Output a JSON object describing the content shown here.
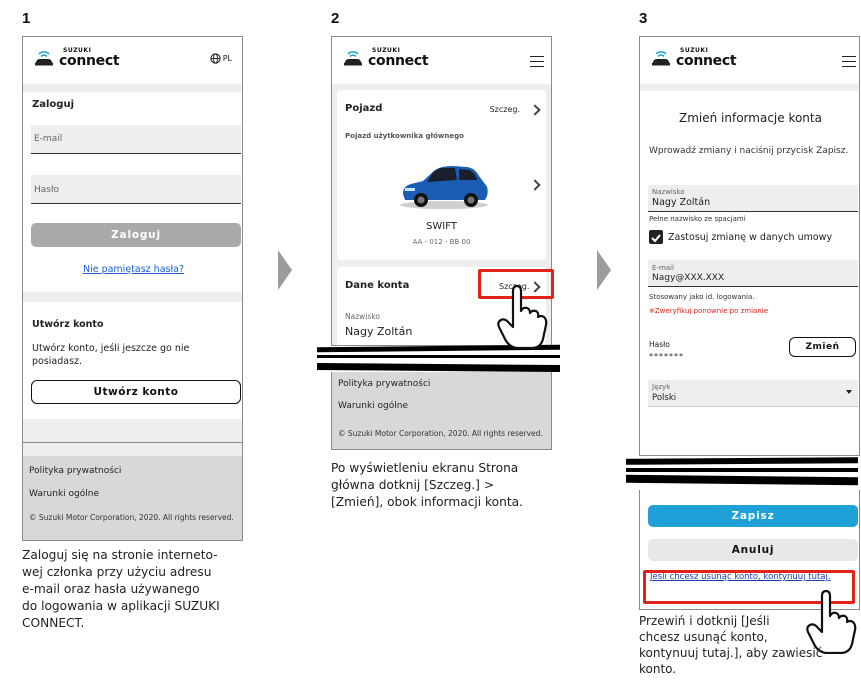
{
  "steps": [
    "1",
    "2",
    "3"
  ],
  "logo": {
    "brand": "SUZUKI",
    "product": "connect"
  },
  "screen1": {
    "lang": "PL",
    "login_title": "Zaloguj",
    "email_placeholder": "E-mail",
    "password_placeholder": "Hasło",
    "login_button": "Zaloguj",
    "forgot_link": "Nie pamiętasz hasła?",
    "create_title": "Utwórz konto",
    "create_text": "Utwórz konto, jeśli jeszcze go nie posiadasz.",
    "create_button": "Utwórz konto",
    "privacy": "Polityka prywatności",
    "terms": "Warunki ogólne",
    "copyright": "© Suzuki Motor Corporation, 2020. All rights reserved."
  },
  "caption1": [
    "Zaloguj się na stronie interneto-",
    "wej członka przy użyciu adresu",
    "e-mail oraz hasła używanego",
    "do logowania w aplikacji SUZUKI",
    "CONNECT."
  ],
  "screen2": {
    "vehicle_title": "Pojazd",
    "details": "Szczeg.",
    "vehicle_subtitle": "Pojazd użytkownika głównego",
    "model": "SWIFT",
    "plate": "AA - 012 - BB 00",
    "account_title": "Dane konta",
    "account_details": "Szczeg.",
    "surname_label": "Nazwisko",
    "surname_value": "Nagy Zoltán",
    "privacy": "Polityka prywatności",
    "terms": "Warunki ogólne",
    "copyright": "© Suzuki Motor Corporation, 2020. All rights reserved."
  },
  "caption2": [
    "Po wyświetleniu ekranu Strona",
    "główna dotknij [Szczeg.] >",
    "[Zmień], obok informacji konta."
  ],
  "screen3": {
    "title": "Zmień informacje konta",
    "intro": "Wprowadź zmiany i naciśnij przycisk Zapisz.",
    "surname_label": "Nazwisko",
    "surname_value": "Nagy Zoltán",
    "surname_hint": "Pełne nazwisko ze spacjami",
    "apply_contracts": "Zastosuj zmianę w danych umowy",
    "email_label": "E-mail",
    "email_value": "Nagy@XXX.XXX",
    "email_hint": "Stosowany jako id. logowania.",
    "email_warning": "※Zweryfikuj ponownie po zmianie",
    "password_label": "Hasło",
    "password_value": "*******",
    "change_button": "Zmień",
    "language_label": "Język",
    "language_value": "Polski",
    "save_button": "Zapisz",
    "cancel_button": "Anuluj",
    "delete_link": "Jeśli chcesz usunąć konto, kontynuuj tutaj."
  },
  "caption3": [
    "Przewiń i dotknij [Jeśli",
    "chcesz usunąć konto,",
    "kontynuuj tutaj.], aby zawiesić",
    "konto."
  ],
  "colors": {
    "accent_blue": "#1fa0d6",
    "red_highlight": "#e2231a",
    "link_blue": "#1a5fd0"
  }
}
